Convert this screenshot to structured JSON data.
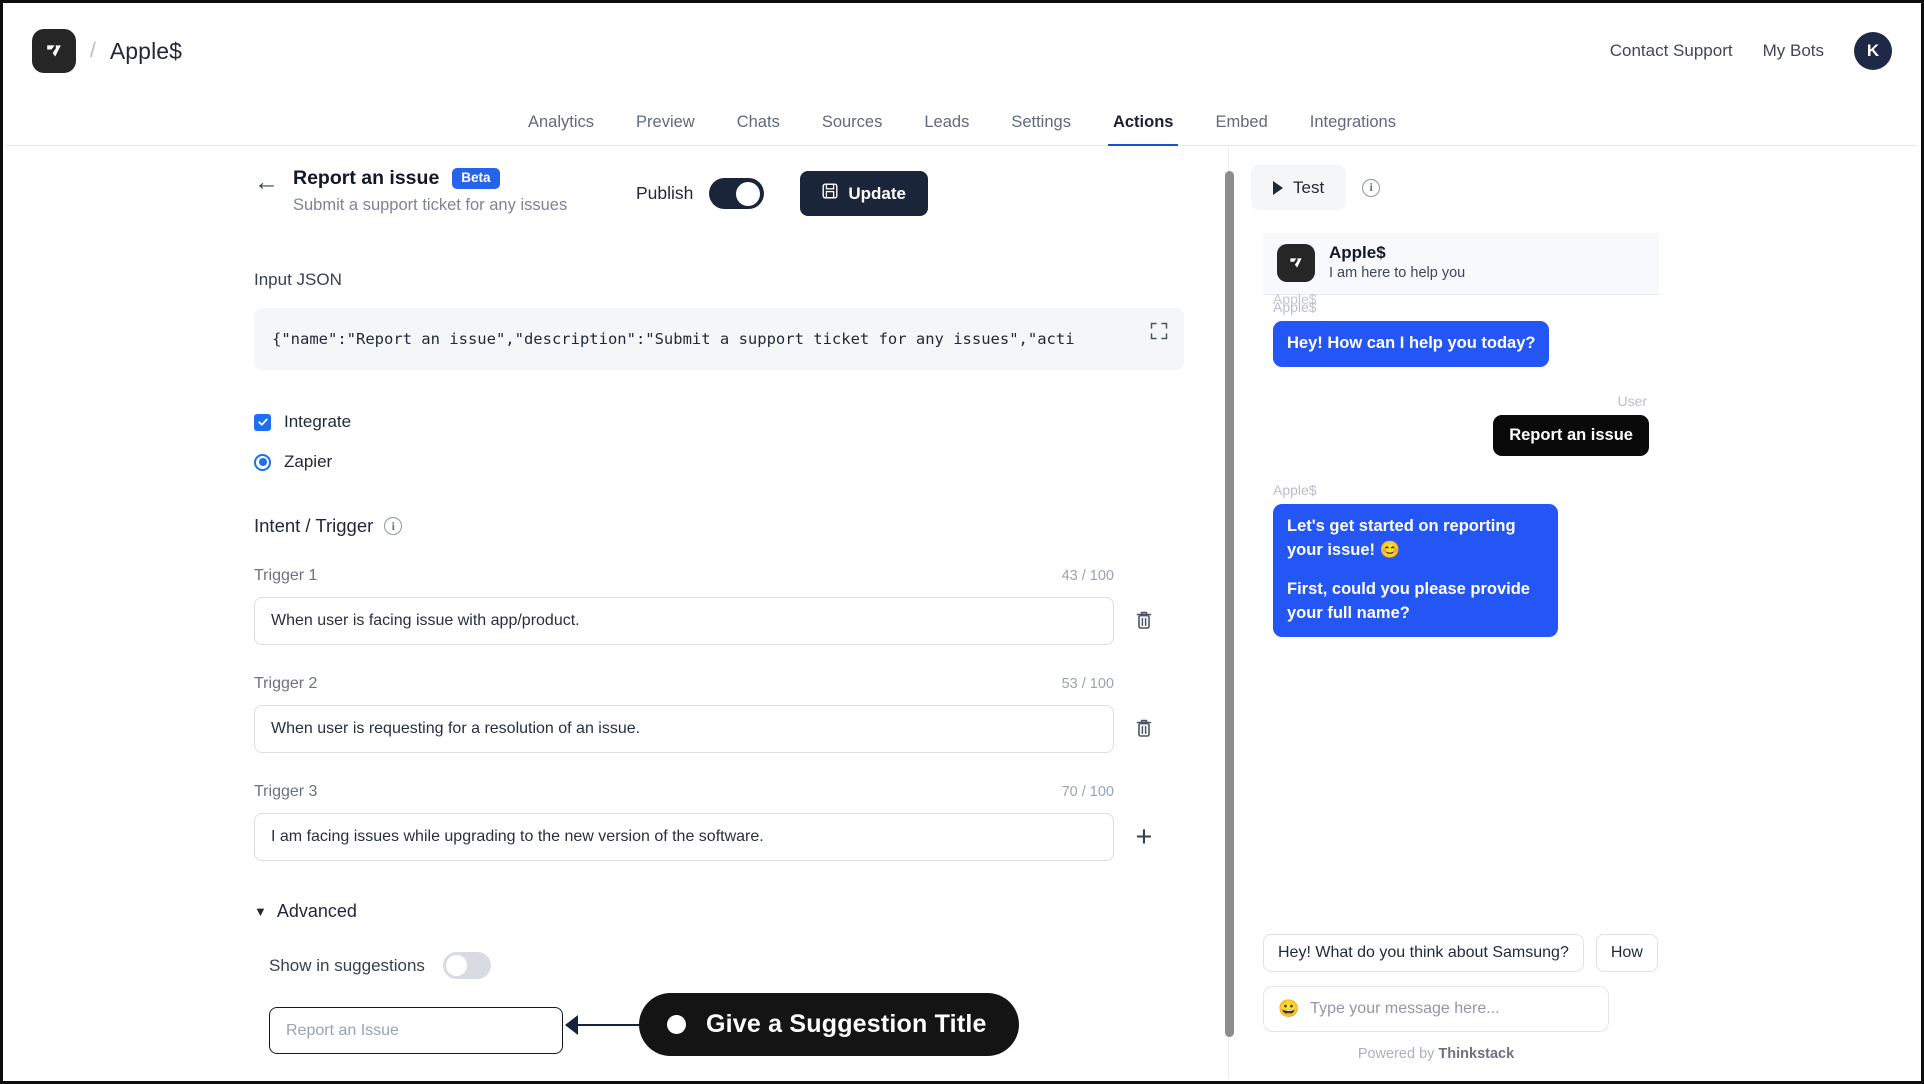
{
  "topbar": {
    "brand_name": "Apple$",
    "separator": "/",
    "logo_icon": "thinkstack-logo-icon",
    "contact_support": "Contact Support",
    "my_bots": "My Bots",
    "avatar_initial": "K"
  },
  "nav": {
    "tabs": [
      {
        "label": "Analytics",
        "active": false
      },
      {
        "label": "Preview",
        "active": false
      },
      {
        "label": "Chats",
        "active": false
      },
      {
        "label": "Sources",
        "active": false
      },
      {
        "label": "Leads",
        "active": false
      },
      {
        "label": "Settings",
        "active": false
      },
      {
        "label": "Actions",
        "active": true
      },
      {
        "label": "Embed",
        "active": false
      },
      {
        "label": "Integrations",
        "active": false
      }
    ]
  },
  "action": {
    "back_icon": "arrow-left-icon",
    "title": "Report an issue",
    "badge": "Beta",
    "subtitle": "Submit a support ticket for any issues",
    "publish_label": "Publish",
    "publish_on": true,
    "update_label": "Update",
    "update_icon": "save-icon"
  },
  "input_json": {
    "label": "Input JSON",
    "value": "{\"name\":\"Report an issue\",\"description\":\"Submit a support ticket for any issues\",\"acti",
    "expand_icon": "expand-icon"
  },
  "options": {
    "integrate_label": "Integrate",
    "integrate_checked": true,
    "zapier_label": "Zapier",
    "zapier_selected": true
  },
  "intent": {
    "section_title": "Intent / Trigger",
    "info_icon": "info-icon",
    "triggers": [
      {
        "label": "Trigger 1",
        "count": "43 / 100",
        "value": "When user is facing issue with app/product.",
        "action_icon": "trash-icon"
      },
      {
        "label": "Trigger 2",
        "count": "53 / 100",
        "value": "When user is requesting for a resolution of an issue.",
        "action_icon": "trash-icon"
      },
      {
        "label": "Trigger 3",
        "count": "70 / 100",
        "value": "I am facing issues while upgrading to the new version of the software.",
        "action_icon": "plus-icon"
      }
    ]
  },
  "advanced": {
    "caret": "▼",
    "label": "Advanced",
    "show_in_suggestions_label": "Show in suggestions",
    "show_in_suggestions_on": false,
    "suggestion_title_value": "",
    "suggestion_title_placeholder": "Report an Issue"
  },
  "callout": {
    "text": "Give a Suggestion Title"
  },
  "chat": {
    "test_label": "Test",
    "test_icon": "play-icon",
    "info_icon": "info-icon",
    "header_name": "Apple$",
    "header_sub": "I am here to help you",
    "ghost_name": "Apple$",
    "messages": [
      {
        "sender": "Apple$",
        "side": "left",
        "type": "bot",
        "lines": [
          "Hey! How can I help you today?"
        ]
      },
      {
        "sender": "User",
        "side": "right",
        "type": "user",
        "lines": [
          "Report an issue"
        ]
      },
      {
        "sender": "Apple$",
        "side": "left",
        "type": "bot",
        "lines": [
          "Let's get started on reporting your issue! 😊",
          "First, could you please provide your full name?"
        ]
      }
    ],
    "chips": [
      "Hey! What do you think about Samsung?",
      "How"
    ],
    "composer_emoji": "😀",
    "composer_placeholder": "Type your message here...",
    "powered_prefix": "Powered by ",
    "powered_brand": "Thinkstack"
  },
  "colors": {
    "accent_blue": "#2456f6",
    "dark": "#1b2539",
    "tab_underline": "#1d4ed8",
    "badge_blue": "#2563eb"
  }
}
